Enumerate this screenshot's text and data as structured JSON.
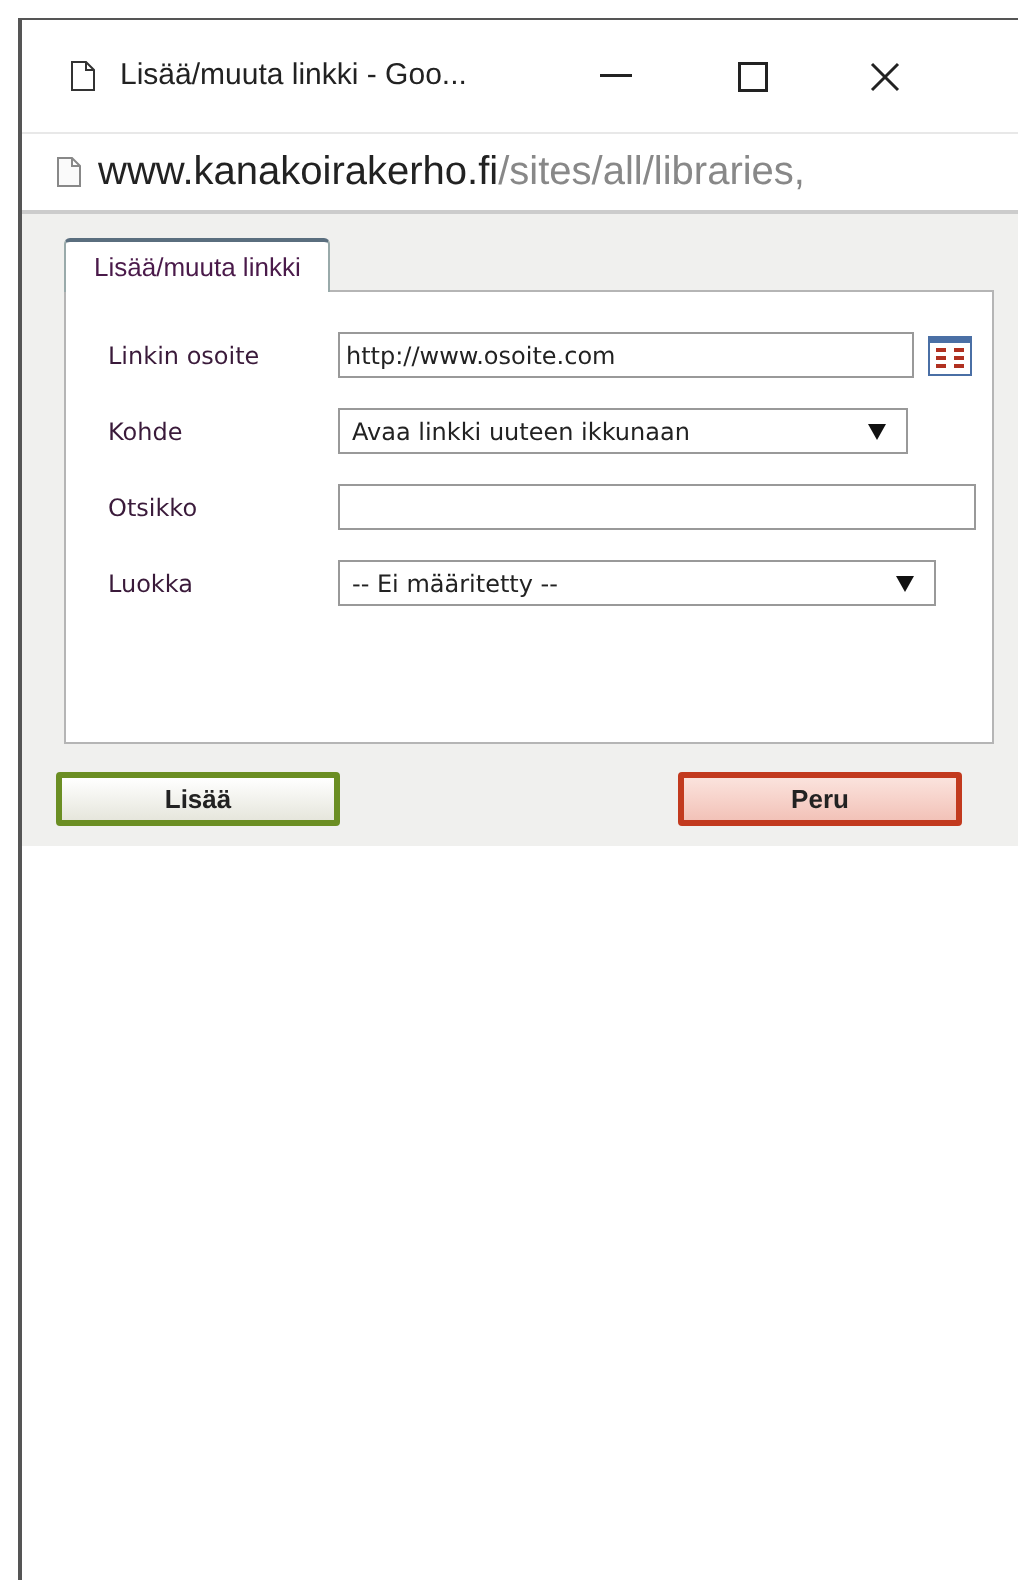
{
  "window": {
    "title": "Lisää/muuta linkki - Goo..."
  },
  "address_bar": {
    "host": "www.kanakoirakerho.fi",
    "path": "/sites/all/libraries,"
  },
  "tabs": [
    {
      "label": "Lisää/muuta linkki",
      "selected": true
    }
  ],
  "fields": [
    {
      "kind": "url",
      "label": "Linkin osoite",
      "value": "http://www.osoite.com"
    },
    {
      "kind": "select",
      "label": "Kohde",
      "value": "Avaa linkki uuteen ikkunaan"
    },
    {
      "kind": "text",
      "label": "Otsikko"
    },
    {
      "kind": "select",
      "label": "Luokka",
      "value": "-- Ei määritetty --"
    }
  ],
  "buttons": [
    {
      "kind": "confirm",
      "label": "Lisää"
    },
    {
      "kind": "cancel",
      "label": "Peru"
    }
  ]
}
